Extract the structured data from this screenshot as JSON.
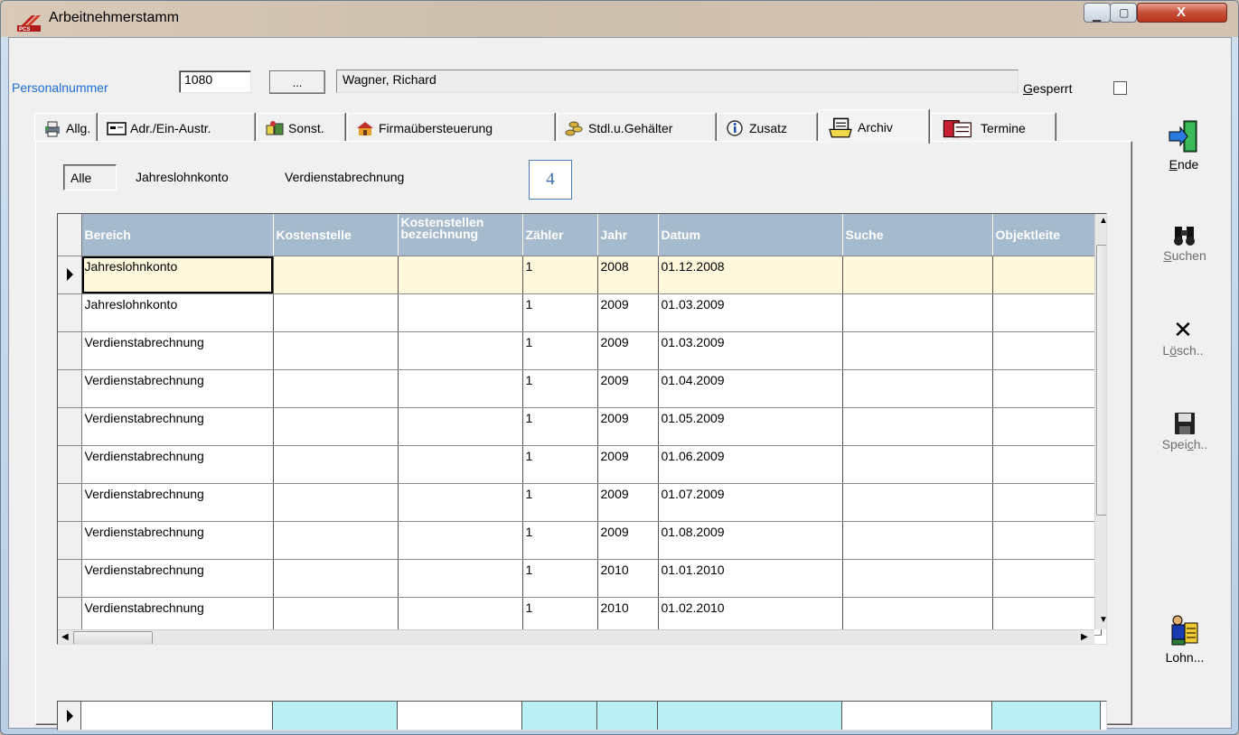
{
  "window": {
    "title": "Arbeitnehmerstamm",
    "icon": "pcs-app-icon",
    "close_label": "X"
  },
  "header": {
    "personalnummer_label": "Personalnummer",
    "personalnummer_value": "1080",
    "lookup_button": "...",
    "name_value": "Wagner, Richard",
    "gesperrt_label": "Gesperrt",
    "gesperrt_checked": false
  },
  "tabs": [
    {
      "label": "Allg.",
      "icon": "printer-icon"
    },
    {
      "label": "Adr./Ein-Austr.",
      "icon": "card-icon"
    },
    {
      "label": "Sonst.",
      "icon": "bags-icon"
    },
    {
      "label": "Firmaübersteuerung",
      "icon": "house-icon"
    },
    {
      "label": "Stdl.u.Gehälter",
      "icon": "coins-icon"
    },
    {
      "label": "Zusatz",
      "icon": "info-icon"
    },
    {
      "label": "Archiv",
      "icon": "archive-icon",
      "active": true
    },
    {
      "label": "Termine",
      "icon": "calendar-icon"
    }
  ],
  "filters": {
    "alle": "Alle",
    "jahreslohnkonto": "Jahreslohnkonto",
    "verdienstabrechnung": "Verdienstabrechnung",
    "badge": "4"
  },
  "grid": {
    "columns": [
      "Bereich",
      "Kostenstelle",
      "Kostenstellen bezeichnung",
      "Zähler",
      "Jahr",
      "Datum",
      "Suche",
      "Objektleite"
    ],
    "rows": [
      [
        "Jahreslohnkonto",
        "",
        "",
        "1",
        "2008",
        "01.12.2008",
        "",
        ""
      ],
      [
        "Jahreslohnkonto",
        "",
        "",
        "1",
        "2009",
        "01.03.2009",
        "",
        ""
      ],
      [
        "Verdienstabrechnung",
        "",
        "",
        "1",
        "2009",
        "01.03.2009",
        "",
        ""
      ],
      [
        "Verdienstabrechnung",
        "",
        "",
        "1",
        "2009",
        "01.04.2009",
        "",
        ""
      ],
      [
        "Verdienstabrechnung",
        "",
        "",
        "1",
        "2009",
        "01.05.2009",
        "",
        ""
      ],
      [
        "Verdienstabrechnung",
        "",
        "",
        "1",
        "2009",
        "01.06.2009",
        "",
        ""
      ],
      [
        "Verdienstabrechnung",
        "",
        "",
        "1",
        "2009",
        "01.07.2009",
        "",
        ""
      ],
      [
        "Verdienstabrechnung",
        "",
        "",
        "1",
        "2009",
        "01.08.2009",
        "",
        ""
      ],
      [
        "Verdienstabrechnung",
        "",
        "",
        "1",
        "2010",
        "01.01.2010",
        "",
        ""
      ],
      [
        "Verdienstabrechnung",
        "",
        "",
        "1",
        "2010",
        "01.02.2010",
        "",
        ""
      ]
    ],
    "current_row": 0
  },
  "side": {
    "ende": "Ende",
    "suchen": "Suchen",
    "loeschen": "Lösch..",
    "speichern": "Speich..",
    "lohn": "Lohn..."
  },
  "colors": {
    "header_bg": "#a6bacd",
    "current_row_bg": "#fff8dc",
    "totals_cyan": "#b8f0f5",
    "label_blue": "#1c6bd4"
  }
}
